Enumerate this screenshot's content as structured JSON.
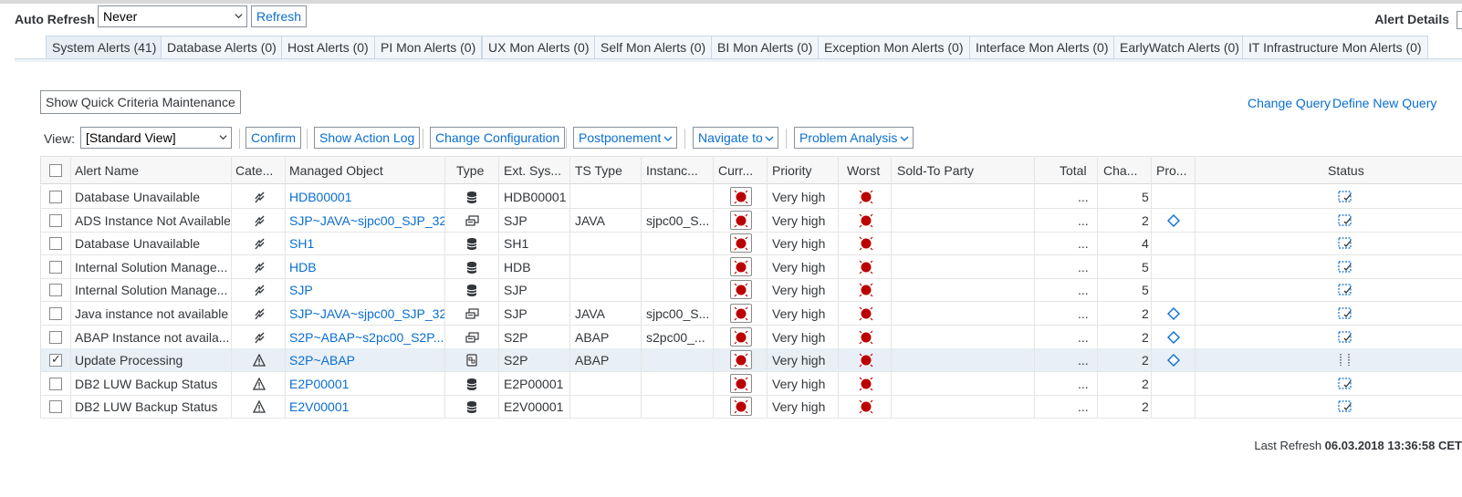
{
  "toolbar": {
    "auto_refresh_label": "Auto Refresh",
    "auto_refresh_value": "Never",
    "refresh_button": "Refresh",
    "alert_details_label": "Alert Details"
  },
  "tabs": [
    "System Alerts (41)",
    "Database Alerts (0)",
    "Host Alerts (0)",
    "PI Mon Alerts (0)",
    "UX Mon Alerts (0)",
    "Self Mon Alerts (0)",
    "BI Mon Alerts (0)",
    "Exception Mon Alerts (0)",
    "Interface Mon Alerts (0)",
    "EarlyWatch Alerts (0)",
    "IT Infrastructure Mon Alerts (0)"
  ],
  "actions": {
    "quick_criteria": "Show Quick Criteria Maintenance",
    "change_query": "Change Query",
    "define_new_query": "Define New Query",
    "view_label": "View:",
    "view_value": "[Standard View]",
    "confirm": "Confirm",
    "show_action_log": "Show Action Log",
    "change_configuration": "Change Configuration",
    "postponement": "Postponement",
    "navigate_to": "Navigate to",
    "problem_analysis": "Problem Analysis"
  },
  "columns": {
    "alert_name": "Alert Name",
    "category": "Cate...",
    "managed_object": "Managed Object",
    "type": "Type",
    "ext_system": "Ext. Sys...",
    "ts_type": "TS Type",
    "instance": "Instanc...",
    "current": "Curr...",
    "priority": "Priority",
    "worst": "Worst",
    "sold_to": "Sold-To Party",
    "total": "Total",
    "changes": "Cha...",
    "processor": "Pro...",
    "status": "Status"
  },
  "rows": [
    {
      "name": "Database Unavailable",
      "cat": "flash",
      "mo": "HDB00001",
      "type": "db",
      "ext": "HDB00001",
      "ts": "",
      "inst": "",
      "priority": "Very high",
      "total": "...",
      "changes": "5",
      "proc": false,
      "checked": false
    },
    {
      "name": "ADS Instance Not Available",
      "cat": "flash",
      "mo": "SJP~JAVA~sjpc00_SJP_32",
      "type": "inst",
      "ext": "SJP",
      "ts": "JAVA",
      "inst": "sjpc00_S...",
      "priority": "Very high",
      "total": "...",
      "changes": "2",
      "proc": true,
      "checked": false
    },
    {
      "name": "Database Unavailable",
      "cat": "flash",
      "mo": "SH1",
      "type": "db",
      "ext": "SH1",
      "ts": "",
      "inst": "",
      "priority": "Very high",
      "total": "...",
      "changes": "4",
      "proc": false,
      "checked": false
    },
    {
      "name": "Internal Solution Manage...",
      "cat": "flash",
      "mo": "HDB",
      "type": "db",
      "ext": "HDB",
      "ts": "",
      "inst": "",
      "priority": "Very high",
      "total": "...",
      "changes": "5",
      "proc": false,
      "checked": false
    },
    {
      "name": "Internal Solution Manage...",
      "cat": "flash",
      "mo": "SJP",
      "type": "db",
      "ext": "SJP",
      "ts": "",
      "inst": "",
      "priority": "Very high",
      "total": "...",
      "changes": "5",
      "proc": false,
      "checked": false
    },
    {
      "name": "Java instance not available",
      "cat": "flash",
      "mo": "SJP~JAVA~sjpc00_SJP_32",
      "type": "inst",
      "ext": "SJP",
      "ts": "JAVA",
      "inst": "sjpc00_S...",
      "priority": "Very high",
      "total": "...",
      "changes": "2",
      "proc": true,
      "checked": false
    },
    {
      "name": "ABAP Instance not availa...",
      "cat": "flash",
      "mo": "S2P~ABAP~s2pc00_S2P...",
      "type": "inst",
      "ext": "S2P",
      "ts": "ABAP",
      "inst": "s2pc00_...",
      "priority": "Very high",
      "total": "...",
      "changes": "2",
      "proc": true,
      "checked": false
    },
    {
      "name": "Update Processing",
      "cat": "warn",
      "mo": "S2P~ABAP",
      "type": "sys",
      "ext": "S2P",
      "ts": "ABAP",
      "inst": "",
      "priority": "Very high",
      "total": "...",
      "changes": "2",
      "proc": true,
      "checked": true
    },
    {
      "name": "DB2 LUW Backup Status",
      "cat": "warn",
      "mo": "E2P00001",
      "type": "db",
      "ext": "E2P00001",
      "ts": "",
      "inst": "",
      "priority": "Very high",
      "total": "...",
      "changes": "2",
      "proc": false,
      "checked": false
    },
    {
      "name": "DB2 LUW Backup Status",
      "cat": "warn",
      "mo": "E2V00001",
      "type": "db",
      "ext": "E2V00001",
      "ts": "",
      "inst": "",
      "priority": "Very high",
      "total": "...",
      "changes": "2",
      "proc": false,
      "checked": false
    }
  ],
  "footer": {
    "last_refresh_label": "Last Refresh",
    "last_refresh_value": "06.03.2018 13:36:58 CET"
  },
  "colors": {
    "link": "#0a6ed1",
    "alert_red": "#bb0000",
    "selected_row": "#e8eff6"
  }
}
